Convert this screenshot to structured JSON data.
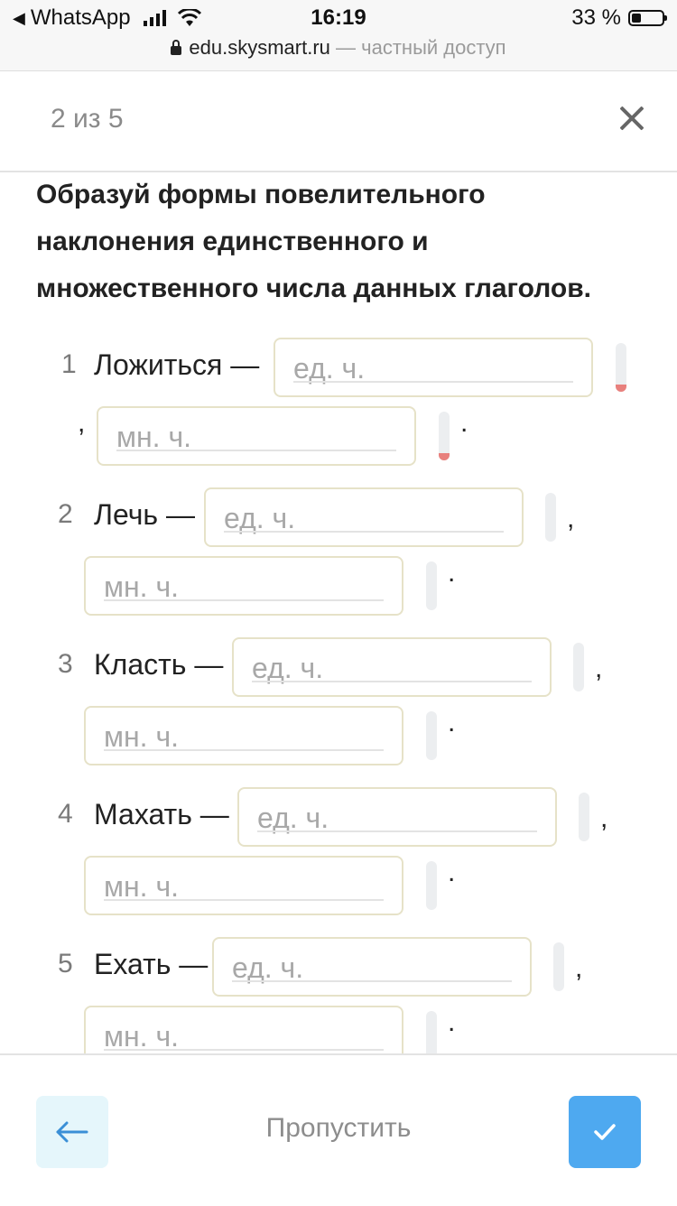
{
  "status_bar": {
    "back_app": "WhatsApp",
    "time": "16:19",
    "battery": "33 %"
  },
  "url_bar": {
    "domain": "edu.skysmart.ru",
    "note": "— частный доступ"
  },
  "header": {
    "progress": "2 из 5"
  },
  "task": {
    "question": "Образуй формы повелительного наклонения единственного и множественного числа данных глаголов.",
    "items": [
      {
        "num": "1",
        "word": "Ложиться —",
        "singular": {
          "placeholder": "ед. ч.",
          "value": ""
        },
        "plural": {
          "placeholder": "мн. ч.",
          "value": ""
        },
        "sep": ",",
        "end": ".",
        "state": "error"
      },
      {
        "num": "2",
        "word": "Лечь —",
        "singular": {
          "placeholder": "ед. ч.",
          "value": ""
        },
        "plural": {
          "placeholder": "мн. ч.",
          "value": ""
        },
        "sep": ",",
        "end": ".",
        "state": "empty"
      },
      {
        "num": "3",
        "word": "Класть —",
        "singular": {
          "placeholder": "ед. ч.",
          "value": ""
        },
        "plural": {
          "placeholder": "мн. ч.",
          "value": ""
        },
        "sep": ",",
        "end": ".",
        "state": "empty"
      },
      {
        "num": "4",
        "word": "Махать —",
        "singular": {
          "placeholder": "ед. ч.",
          "value": ""
        },
        "plural": {
          "placeholder": "мн. ч.",
          "value": ""
        },
        "sep": ",",
        "end": ".",
        "state": "empty"
      },
      {
        "num": "5",
        "word": "Ехать —",
        "singular": {
          "placeholder": "ед. ч.",
          "value": ""
        },
        "plural": {
          "placeholder": "мн. ч.",
          "value": ""
        },
        "sep": ",",
        "end": ".",
        "state": "empty"
      }
    ]
  },
  "footer": {
    "skip_label": "Пропустить"
  },
  "colors": {
    "accent": "#4ea9f0",
    "back_button_bg": "#e5f6fb",
    "error_marker": "#e8807d",
    "field_border": "#e6e2c8"
  },
  "icons": {
    "back": "arrow-left-icon",
    "confirm": "checkmark-icon",
    "close": "close-icon"
  }
}
